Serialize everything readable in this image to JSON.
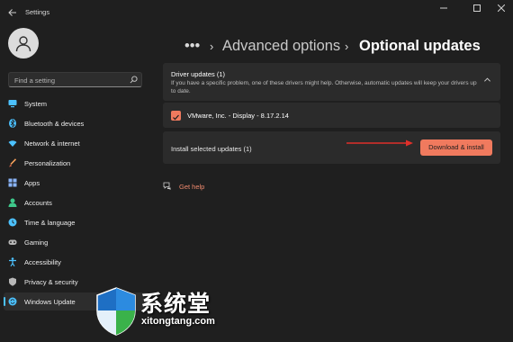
{
  "window": {
    "title": "Settings",
    "controls": [
      "minimize",
      "maximize",
      "close"
    ]
  },
  "sidebar": {
    "search_placeholder": "Find a setting",
    "items": [
      {
        "label": "System",
        "icon": "monitor-icon",
        "color": "#4cc2ff"
      },
      {
        "label": "Bluetooth & devices",
        "icon": "bluetooth-icon",
        "color": "#4cc2ff"
      },
      {
        "label": "Network & internet",
        "icon": "wifi-icon",
        "color": "#4cc2ff"
      },
      {
        "label": "Personalization",
        "icon": "brush-icon",
        "color": "#f7a25b"
      },
      {
        "label": "Apps",
        "icon": "apps-icon",
        "color": "#8ab4f8"
      },
      {
        "label": "Accounts",
        "icon": "person-icon",
        "color": "#3ec78a"
      },
      {
        "label": "Time & language",
        "icon": "globe-clock-icon",
        "color": "#4cc2ff"
      },
      {
        "label": "Gaming",
        "icon": "controller-icon",
        "color": "#b8b8b8"
      },
      {
        "label": "Accessibility",
        "icon": "accessibility-icon",
        "color": "#4cc2ff"
      },
      {
        "label": "Privacy & security",
        "icon": "shield-icon",
        "color": "#b8b8b8"
      },
      {
        "label": "Windows Update",
        "icon": "sync-icon",
        "color": "#4cc2ff",
        "active": true
      }
    ]
  },
  "breadcrumb": {
    "ellipsis": "•••",
    "parent": "Advanced options",
    "current": "Optional updates"
  },
  "driver_card": {
    "title": "Driver updates (1)",
    "description": "If you have a specific problem, one of these drivers might help. Otherwise, automatic updates will keep your drivers up to date.",
    "expanded": true
  },
  "driver_item": {
    "label": "VMware, Inc. - Display - 8.17.2.14",
    "checked": true
  },
  "install_bar": {
    "label": "Install selected updates (1)",
    "button_label": "Download & install"
  },
  "get_help": "Get help",
  "watermark": {
    "title": "系统堂",
    "url": "xitongtang.com"
  },
  "colors": {
    "accent": "#f07a5e",
    "nav_highlight": "#4cc2ff",
    "background": "#1f1f1f",
    "card": "#2b2b2b"
  }
}
